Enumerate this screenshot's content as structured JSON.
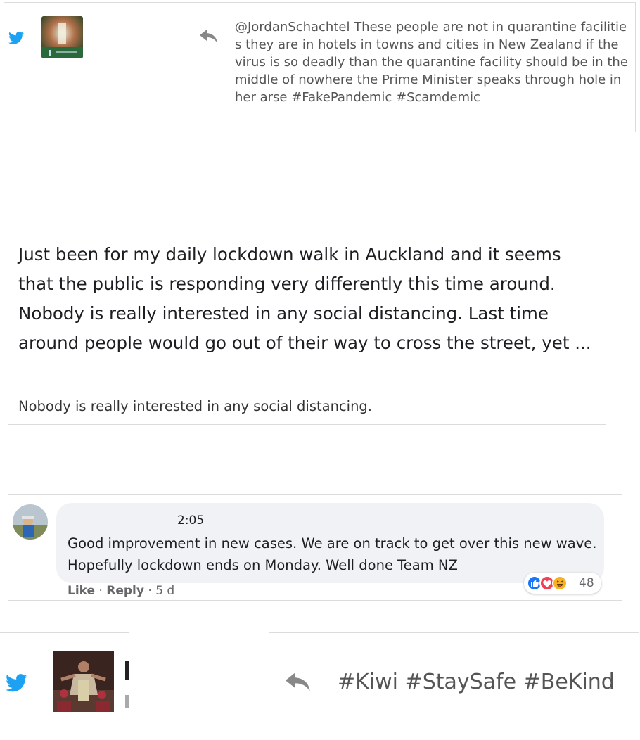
{
  "tweet1": {
    "icon": "twitter-bird-icon",
    "text": "@JordanSchachtel These people are not in quarantine facilities they are in hotels in towns and cities in New Zealand if the virus is so deadly than the quarantine facility should be in the middle of nowhere the Prime Minister speaks through hole in her arse #FakePandemic #Scamdemic"
  },
  "post": {
    "body": "Just been for my daily lockdown walk in Auckland and it seems that the public is responding very differently this time around. Nobody is really interested in any social distancing. Last time around people would go out of their way to cross the street, yet ...",
    "subtitle": "Nobody is really interested in any social distancing."
  },
  "comment": {
    "time": "2:05",
    "text": "Good improvement in new cases. We are on track to get over this new wave. Hopefully lockdown ends on Monday. Well done Team NZ",
    "like_label": "Like",
    "reply_label": "Reply",
    "age": "5 d",
    "reaction_count": "48",
    "colors": {
      "like": "#1877f2",
      "love": "#f33e58",
      "haha": "#f7b125"
    }
  },
  "tweet2": {
    "icon": "twitter-bird-icon",
    "text": "#Kiwi #StaySafe #BeKind"
  },
  "colors": {
    "twitter": "#1da1f2",
    "reply_arrow": "#888888"
  }
}
